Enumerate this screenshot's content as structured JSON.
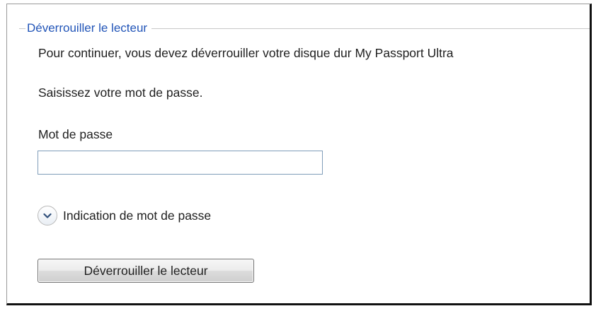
{
  "group": {
    "legend": "Déverrouiller le lecteur"
  },
  "instructions": {
    "continue_text": "Pour continuer, vous devez déverrouiller votre disque dur My Passport Ultra",
    "enter_password_text": "Saisissez votre mot de passe."
  },
  "password": {
    "label": "Mot de passe",
    "value": "",
    "placeholder": ""
  },
  "hint": {
    "label": "Indication de mot de passe",
    "icon": "chevron-down-icon",
    "expanded": false
  },
  "unlock_button": {
    "label": "Déverrouiller le lecteur"
  },
  "colors": {
    "legend_text": "#2255b8",
    "input_border": "#7f9db9",
    "frame_shadow": "#111111"
  }
}
